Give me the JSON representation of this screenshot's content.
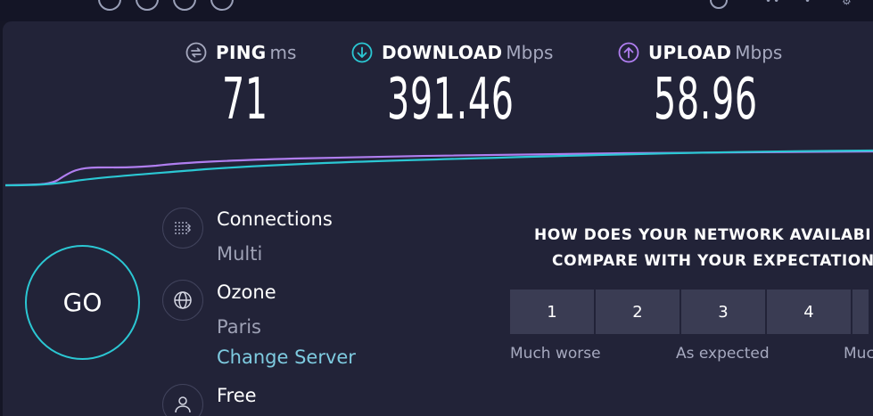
{
  "metrics": {
    "ping": {
      "name": "PING",
      "unit": "ms",
      "value": "71"
    },
    "download": {
      "name": "DOWNLOAD",
      "unit": "Mbps",
      "value": "391.46"
    },
    "upload": {
      "name": "UPLOAD",
      "unit": "Mbps",
      "value": "58.96"
    }
  },
  "go_label": "GO",
  "connections": {
    "title": "Connections",
    "value": "Multi"
  },
  "server": {
    "title": "Ozone",
    "location": "Paris",
    "change_label": "Change Server"
  },
  "provider": {
    "title": "Free"
  },
  "survey": {
    "question_line1": "HOW DOES YOUR NETWORK AVAILABI",
    "question_line2": "COMPARE WITH YOUR EXPECTATION",
    "ratings": [
      "1",
      "2",
      "3",
      "4",
      ""
    ],
    "scale_labels": {
      "low": "Much worse",
      "mid": "As expected",
      "high": "Muc"
    }
  },
  "colors": {
    "accent": "#2bc7d3",
    "upload": "#b07ef0",
    "download": "#2bc7d3",
    "panel": "#222338"
  }
}
